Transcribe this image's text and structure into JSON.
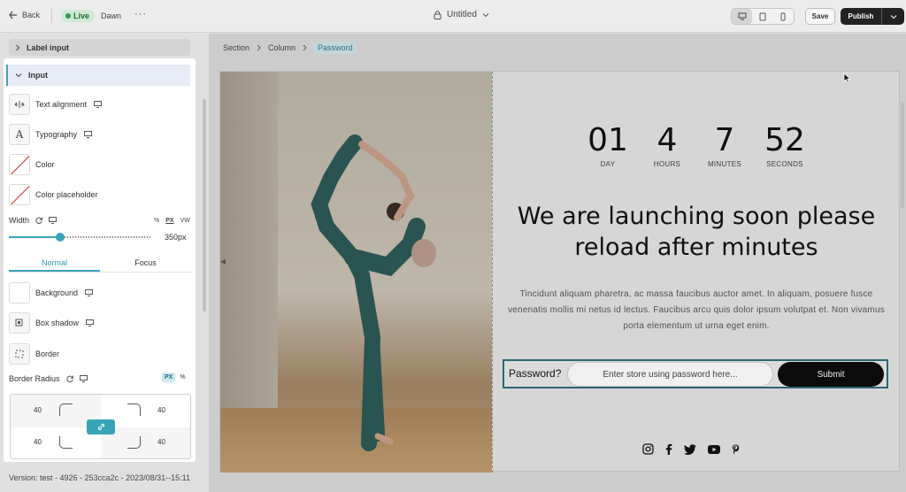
{
  "topbar": {
    "back_label": "Back",
    "live_label": "Live",
    "theme_name": "Dawn",
    "title": "Untitled",
    "save_label": "Save",
    "publish_label": "Publish"
  },
  "breadcrumb": [
    "Section",
    "Column",
    "Password"
  ],
  "panel": {
    "collapsed_section": "Label input",
    "section_title": "Input",
    "properties": {
      "text_alignment": "Text alignment",
      "typography": "Typography",
      "color": "Color",
      "color_placeholder": "Color placeholder",
      "background": "Background",
      "box_shadow": "Box shadow",
      "border": "Border"
    },
    "width": {
      "label": "Width",
      "units": [
        "%",
        "PX",
        "VW"
      ],
      "selected_unit": "PX",
      "value_label": "350px",
      "slider_fraction": 0.36
    },
    "tabs": [
      "Normal",
      "Focus"
    ],
    "active_tab": "Normal",
    "border_radius": {
      "label": "Border Radius",
      "units": [
        "PX",
        "%"
      ],
      "selected_unit": "PX",
      "top_left": "40",
      "top_right": "40",
      "bottom_left": "40",
      "bottom_right": "40"
    },
    "version": "Version: test - 4926 - 253cca2c - 2023/08/31--15:11"
  },
  "preview": {
    "countdown": [
      {
        "value": "01",
        "label": "DAY"
      },
      {
        "value": "4",
        "label": "HOURS"
      },
      {
        "value": "7",
        "label": "MINUTES"
      },
      {
        "value": "52",
        "label": "SECONDS"
      }
    ],
    "headline": "We are launching soon please reload after minutes",
    "paragraph": "Tincidunt aliquam pharetra, ac massa faucibus auctor amet. In aliquam, posuere fusce venenatis mollis mi netus id lectus. Faucibus arcu quis dolor ipsum volutpat et. Non vivamus porta elementum ut urna eget enim.",
    "password_label": "Password?",
    "password_placeholder": "Enter store using password here...",
    "submit_label": "Submit",
    "socials": [
      "instagram-icon",
      "facebook-icon",
      "twitter-icon",
      "youtube-icon",
      "pinterest-icon"
    ]
  },
  "colors": {
    "accent": "#38a4b8",
    "live_badge": "#cfe9d3",
    "publish_button": "#222222",
    "submit_button": "#0c0c0c"
  }
}
